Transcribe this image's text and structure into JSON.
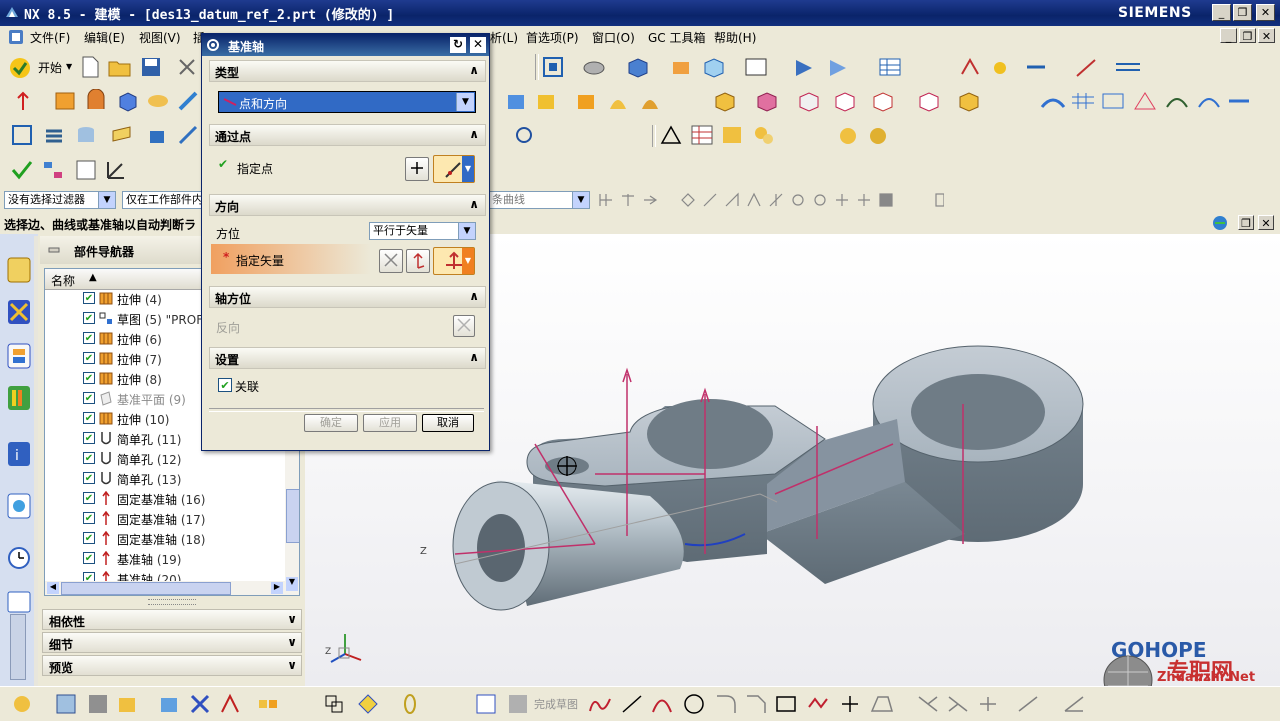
{
  "window": {
    "title": "NX 8.5 - 建模 - [des13_datum_ref_2.prt  (修改的) ]",
    "brand": "SIEMENS"
  },
  "menubar": {
    "items": [
      "文件(F)",
      "编辑(E)",
      "视图(V)",
      "插",
      "首选项(P)",
      "窗口(O)",
      "GC 工具箱",
      "帮助(H)"
    ],
    "hidden_fragment": "析(L)"
  },
  "toolbar": {
    "start_label": "开始"
  },
  "filterbar": {
    "selection_filter": "没有选择过滤器",
    "scope_filter": "仅在工作部件内",
    "curve_rule": "条曲线"
  },
  "status": {
    "prompt": "选择边、曲线或基准轴以自动判断ラ"
  },
  "navigator": {
    "title": "部件导航器",
    "column_name": "名称",
    "rows": [
      {
        "label": "拉伸",
        "num": "(4)",
        "icon": "extrude-icon"
      },
      {
        "label": "草图",
        "num": "(5) \"PROF",
        "icon": "sketch-icon"
      },
      {
        "label": "拉伸",
        "num": "(6)",
        "icon": "extrude-icon"
      },
      {
        "label": "拉伸",
        "num": "(7)",
        "icon": "extrude-icon"
      },
      {
        "label": "拉伸",
        "num": "(8)",
        "icon": "extrude-icon"
      },
      {
        "label": "基准平面",
        "num": "(9)",
        "icon": "datum-plane-icon"
      },
      {
        "label": "拉伸",
        "num": "(10)",
        "icon": "extrude-icon"
      },
      {
        "label": "简单孔",
        "num": "(11)",
        "icon": "hole-icon"
      },
      {
        "label": "简单孔",
        "num": "(12)",
        "icon": "hole-icon"
      },
      {
        "label": "简单孔",
        "num": "(13)",
        "icon": "hole-icon"
      },
      {
        "label": "固定基准轴",
        "num": "(16)",
        "icon": "datum-axis-icon"
      },
      {
        "label": "固定基准轴",
        "num": "(17)",
        "icon": "datum-axis-icon"
      },
      {
        "label": "固定基准轴",
        "num": "(18)",
        "icon": "datum-axis-icon"
      },
      {
        "label": "基准轴",
        "num": "(19)",
        "icon": "datum-axis-icon"
      },
      {
        "label": "基准轴",
        "num": "(20)",
        "icon": "datum-axis-icon"
      }
    ],
    "panels": [
      "相依性",
      "细节",
      "预览"
    ]
  },
  "dialog": {
    "title": "基准轴",
    "section_type": "类型",
    "type_value": "点和方向",
    "section_through_point": "通过点",
    "specify_point": "指定点",
    "section_direction": "方向",
    "orientation_label": "方位",
    "orientation_value": "平行于矢量",
    "specify_vector": "指定矢量",
    "section_axis_orientation": "轴方位",
    "reverse_label": "反向",
    "section_settings": "设置",
    "associative_label": "关联",
    "ok": "确定",
    "apply": "应用",
    "cancel": "取消"
  },
  "bottombar": {
    "finish_sketch": "完成草图"
  },
  "watermark": {
    "brand": "GOHOPE",
    "site": "Zhuanzhi.Net",
    "cn": "专职网"
  },
  "colors": {
    "title_bar": "#0a246a",
    "model_gray": "#8d9aa3",
    "datum_magenta": "#c0306a",
    "required_orange": "#f0a060"
  }
}
